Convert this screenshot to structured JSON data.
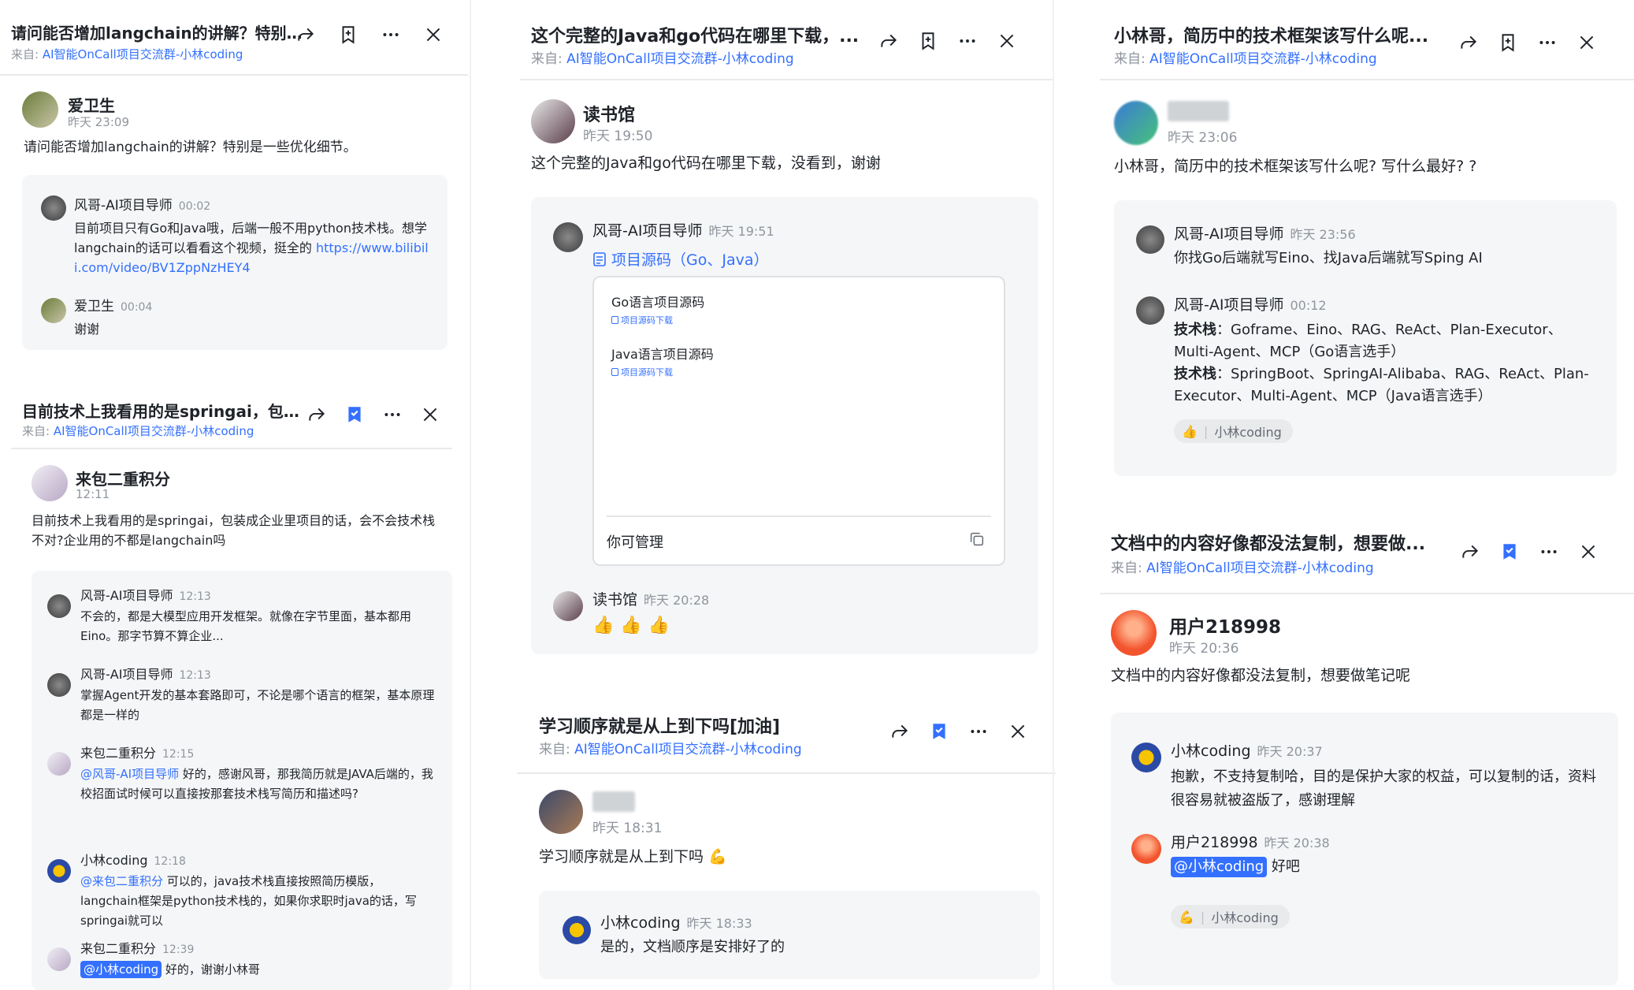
{
  "common": {
    "source_prefix": "来自: ",
    "source_group": "AI智能OnCall项目交流群-小林coding"
  },
  "c1": {
    "title": "请问能否增加langchain的讲解？特别...",
    "author": "爱卫生",
    "time": "昨天 23:09",
    "text": "请问能否增加langchain的讲解？特别是一些优化细节。",
    "r1": {
      "name": "风哥-AI项目导师",
      "time": "00:02",
      "text": "目前项目只有Go和Java哦，后端一般不用python技术栈。想学langchain的话可以看看这个视频，挺全的 ",
      "link": "https://www.bilibili.com/video/BV1ZppNzHEY4"
    },
    "r2": {
      "name": "爱卫生",
      "time": "00:04",
      "text": "谢谢"
    }
  },
  "c2": {
    "title": "目前技术上我看用的是springai，包装...",
    "author": "来包二重积分",
    "time": "12:11",
    "text": "目前技术上我看用的是springai，包装成企业里项目的话，会不会技术栈不对?企业用的不都是langchain吗",
    "r1": {
      "name": "风哥-AI项目导师",
      "time": "12:13",
      "text": "不会的，都是大模型应用开发框架。就像在字节里面，基本都用Eino。那字节算不算企业..."
    },
    "r2": {
      "name": "风哥-AI项目导师",
      "time": "12:13",
      "text": "掌握Agent开发的基本套路即可，不论是哪个语言的框架，基本原理都是一样的"
    },
    "r3": {
      "name": "来包二重积分",
      "time": "12:15",
      "mention": "@风哥-AI项目导师",
      "text": " 好的，感谢风哥，那我简历就是JAVA后端的，我校招面试时候可以直接按那套技术栈写简历和描述吗?"
    },
    "r4": {
      "name": "小林coding",
      "time": "12:18",
      "mention": "@来包二重积分",
      "text": " 可以的，java技术栈直接按照简历模版，langchain框架是python技术栈的，如果你求职时java的话，写springai就可以"
    },
    "r5": {
      "name": "来包二重积分",
      "time": "12:39",
      "mention": "@小林coding",
      "text": " 好的，谢谢小林哥"
    }
  },
  "c3": {
    "title": "这个完整的Java和go代码在哪里下载，...",
    "author": "读书馆",
    "time": "昨天 19:50",
    "text": "这个完整的Java和go代码在哪里下载，没看到，谢谢",
    "r1": {
      "name": "风哥-AI项目导师",
      "time": "昨天 19:51",
      "doc_title": "项目源码（Go、Java）"
    },
    "doc": {
      "item1": "Go语言项目源码",
      "sub1": "项目源码下载",
      "item2": "Java语言项目源码",
      "sub2": "项目源码下载",
      "footer": "你可管理"
    },
    "r2": {
      "name": "读书馆",
      "time": "昨天 20:28"
    }
  },
  "c4": {
    "title": "学习顺序就是从上到下吗[加油]",
    "time": "昨天 18:31",
    "text": "学习顺序就是从上到下吗",
    "r1": {
      "name": "小林coding",
      "time": "昨天 18:33",
      "text": "是的，文档顺序是安排好了的"
    }
  },
  "c5": {
    "title": "小林哥，简历中的技术框架该写什么呢...",
    "time": "昨天 23:06",
    "text": "小林哥，简历中的技术框架该写什么呢? 写什么最好? ?",
    "r1": {
      "name": "风哥-AI项目导师",
      "time": "昨天 23:56",
      "text": "你找Go后端就写Eino、找Java后端就写Sping AI"
    },
    "r2": {
      "name": "风哥-AI项目导师",
      "time": "00:12",
      "label1": "技术栈",
      "text1": "：Goframe、Eino、RAG、ReAct、Plan-Executor、Multi-Agent、MCP（Go语言选手）",
      "label2": "技术栈",
      "text2": "：SpringBoot、SpringAI-Alibaba、RAG、ReAct、Plan-Executor、Multi-Agent、MCP（Java语言选手）"
    },
    "reaction_name": "小林coding"
  },
  "c6": {
    "title": "文档中的内容好像都没法复制，想要做...",
    "author": "用户218998",
    "time": "昨天 20:36",
    "text": "文档中的内容好像都没法复制，想要做笔记呢",
    "r1": {
      "name": "小林coding",
      "time": "昨天 20:37",
      "text": "抱歉，不支持复制哈，目的是保护大家的权益，可以复制的话，资料很容易就被盗版了，感谢理解"
    },
    "r2": {
      "name": "用户218998",
      "time": "昨天 20:38",
      "mention": "@小林coding",
      "text": " 好吧"
    },
    "reaction_name": "小林coding"
  },
  "colors": {
    "accent": "#3370ff",
    "bookmark_active": "#3370ff",
    "thread_bg": "#f5f6f7"
  }
}
